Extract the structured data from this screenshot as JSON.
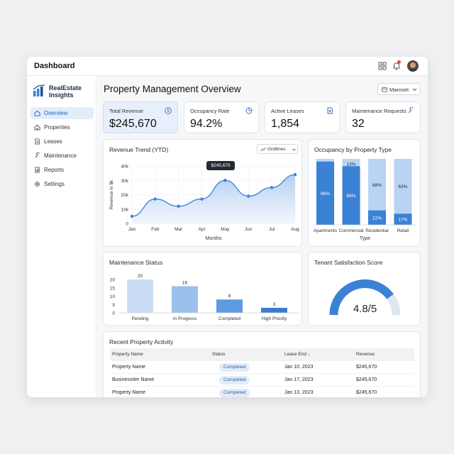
{
  "app": {
    "title": "Dashboard"
  },
  "sidebar": {
    "logo_line1": "RealEstate",
    "logo_line2": "Insights",
    "items": [
      {
        "label": "Overview",
        "icon": "home-icon",
        "active": true
      },
      {
        "label": "Properties",
        "icon": "house-icon",
        "active": false
      },
      {
        "label": "Leases",
        "icon": "document-icon",
        "active": false
      },
      {
        "label": "Maintenance",
        "icon": "wrench-icon",
        "active": false
      },
      {
        "label": "Reports",
        "icon": "report-icon",
        "active": false
      },
      {
        "label": "Settings",
        "icon": "gear-icon",
        "active": false
      }
    ]
  },
  "header": {
    "page_title": "Property Management Overview",
    "market_selector": "Maroset"
  },
  "kpis": [
    {
      "label": "Total Revenue",
      "value": "$245,670",
      "icon": "dollar-icon"
    },
    {
      "label": "Occupancy Rate",
      "value": "94.2%",
      "icon": "pie-icon"
    },
    {
      "label": "Active Leases",
      "value": "1,854",
      "icon": "document-icon"
    },
    {
      "label": "Maintenance Requests",
      "value": "32",
      "icon": "wrench-icon"
    }
  ],
  "revenue": {
    "title": "Revenue Trend (YTD)",
    "gridlines_label": "Gridlines",
    "tooltip": "$245,670"
  },
  "occupancy": {
    "title": "Occupancy by Property Type"
  },
  "maintenance": {
    "title": "Maintenance Status"
  },
  "satisfaction": {
    "title": "Tenant Satisfaction Score",
    "score": "4.8/5",
    "fraction": 0.8
  },
  "activity": {
    "title": "Recent Property Activity",
    "columns": [
      "Property Name",
      "Status",
      "Lease End ↓",
      "Revenue"
    ],
    "rows": [
      {
        "name": "Property Name",
        "status": "Completed",
        "lease_end": "Jan 10, 2023",
        "revenue": "$245,670"
      },
      {
        "name": "BusinessIter Name",
        "status": "Completed",
        "lease_end": "Jan 17, 2023",
        "revenue": "$245,670"
      },
      {
        "name": "Property Name",
        "status": "Completed",
        "lease_end": "Jan 13, 2023",
        "revenue": "$245,670"
      }
    ]
  },
  "colors": {
    "accent": "#3b82d6",
    "accent_light": "#b9d4f3",
    "kpi_highlight": "#e6effb"
  },
  "chart_data": [
    {
      "type": "area",
      "title": "Revenue Trend (YTD)",
      "xlabel": "Months",
      "ylabel": "Revenue in $k",
      "categories": [
        "Jan",
        "Feb",
        "Mar",
        "Apr",
        "May",
        "Jun",
        "Jul",
        "Aug"
      ],
      "values": [
        5,
        17,
        12,
        17,
        30,
        19,
        25,
        34
      ],
      "yticks": [
        "0",
        "10k",
        "20k",
        "30k",
        "40k"
      ],
      "ylim": [
        0,
        40
      ],
      "grid": true
    },
    {
      "type": "bar",
      "stacked": true,
      "title": "Occupancy by Property Type",
      "xlabel": "Type",
      "categories": [
        "Apartments",
        "Commercial",
        "Residential",
        "Retail"
      ],
      "series": [
        {
          "values": [
            96,
            89,
            22,
            17
          ],
          "labels": [
            "96%",
            "89%",
            "22%",
            "17%"
          ]
        },
        {
          "values": [
            4,
            11,
            78,
            83
          ],
          "labels": [
            "",
            "13%",
            "88%",
            "63%"
          ]
        }
      ]
    },
    {
      "type": "bar",
      "title": "Maintenance Status",
      "categories": [
        "Pending",
        "In Progress",
        "Completed",
        "High Priority"
      ],
      "values": [
        20,
        16,
        8,
        3
      ],
      "yticks": [
        "0",
        "5",
        "10",
        "15",
        "20"
      ],
      "ylim": [
        0,
        20
      ]
    }
  ]
}
